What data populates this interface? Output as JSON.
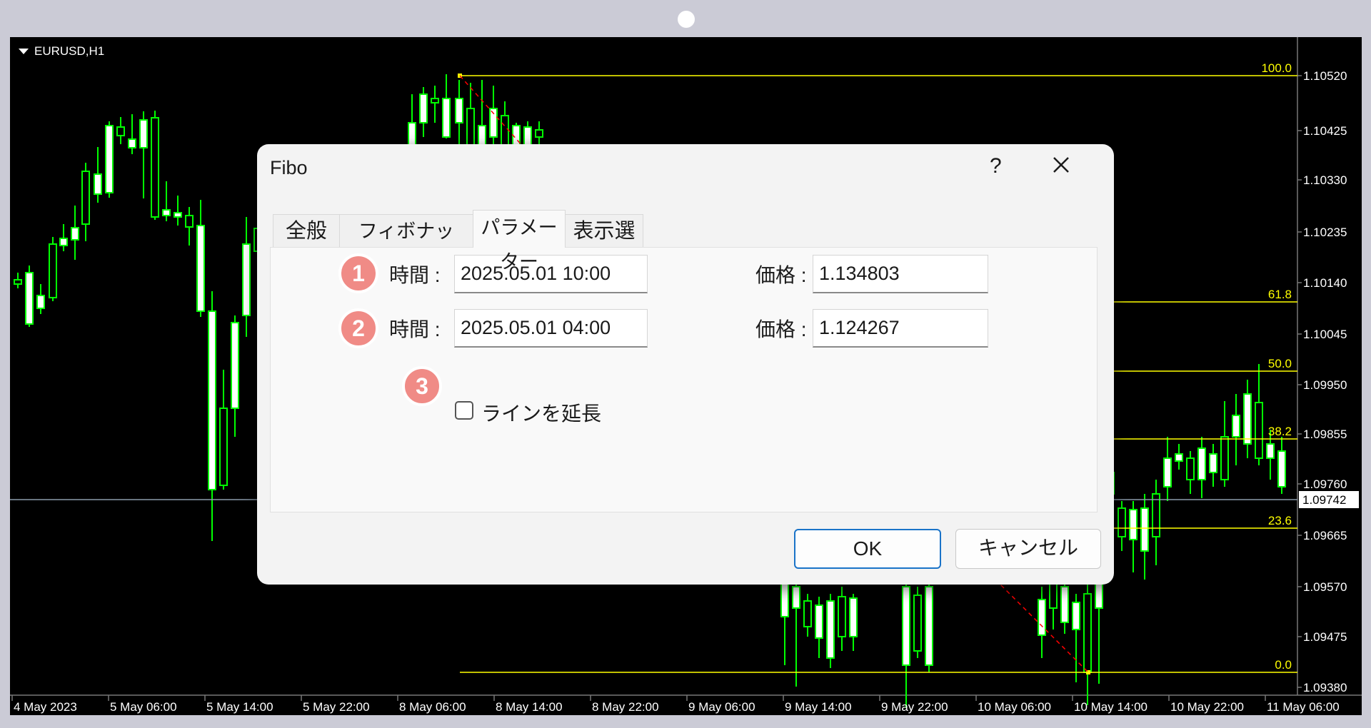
{
  "chart": {
    "symbol": "EURUSD,H1",
    "price_levels": [
      "1.10520",
      "1.10425",
      "1.10330",
      "1.10235",
      "1.10140",
      "1.10045",
      "1.09950",
      "1.09855",
      "1.09760",
      "1.09665",
      "1.09570",
      "1.09475",
      "1.09380"
    ],
    "current_price": "1.09742",
    "time_labels": [
      "4 May 2023",
      "5 May 06:00",
      "5 May 14:00",
      "5 May 22:00",
      "8 May 06:00",
      "8 May 14:00",
      "8 May 22:00",
      "9 May 06:00",
      "9 May 14:00",
      "9 May 22:00",
      "10 May 06:00",
      "10 May 14:00",
      "10 May 22:00",
      "11 May 06:00"
    ],
    "fibo_levels": [
      "100.0",
      "61.8",
      "50.0",
      "38.2",
      "23.6",
      "0.0"
    ],
    "colors": {
      "background": "#000000",
      "candle": "#00ff00",
      "fibo": "#ffff00",
      "trend": "#ff0000",
      "axis_text": "#ffffff"
    }
  },
  "dialog": {
    "title": "Fibo",
    "help_label": "?",
    "tabs": [
      {
        "label": "全般"
      },
      {
        "label": "フィボナッチ・レベル"
      },
      {
        "label": "パラメーター"
      },
      {
        "label": "表示選択"
      }
    ],
    "active_tab": "パラメーター",
    "points": [
      {
        "badge": "1",
        "time_label": "時間 :",
        "time_value": "2025.05.01 10:00",
        "price_label": "価格 :",
        "price_value": "1.134803"
      },
      {
        "badge": "2",
        "time_label": "時間 :",
        "time_value": "2025.05.01 04:00",
        "price_label": "価格 :",
        "price_value": "1.124267"
      }
    ],
    "extend": {
      "badge": "3",
      "label": "ラインを延長",
      "checked": false
    },
    "ok_label": "OK",
    "cancel_label": "キャンセル"
  }
}
